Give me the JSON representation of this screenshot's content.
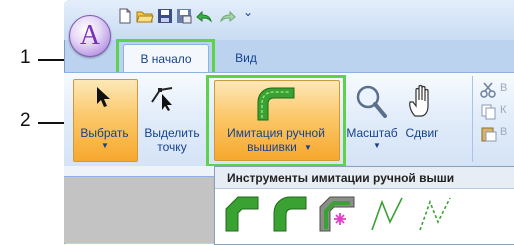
{
  "callouts": {
    "one": "1",
    "two": "2"
  },
  "app": {
    "orb_letter": "A"
  },
  "qat": {
    "dropdown_glyph": "⌄"
  },
  "tabs": [
    {
      "label": "В начало",
      "active": true
    },
    {
      "label": "Вид",
      "active": false
    }
  ],
  "ribbon": {
    "select_label": "Выбрать",
    "select_point_line1": "Выделить",
    "select_point_line2": "точку",
    "imitation_line1": "Имитация ручной",
    "imitation_line2": "вышивки",
    "zoom_label": "Масштаб",
    "pan_label": "Сдвиг",
    "right_group_letters": [
      "В",
      "К",
      "В"
    ]
  },
  "dropdown": {
    "title": "Инструменты имитации ручной выши",
    "tools": [
      "fill-stitch-corner-icon",
      "fill-stitch-curve-icon",
      "fill-stitch-region-icon",
      "running-stitch-icon",
      "dotted-stitch-icon"
    ]
  },
  "colors": {
    "accent_green": "#5fd24c",
    "ribbon_text": "#15428b",
    "tool_green": "#3aa232"
  }
}
